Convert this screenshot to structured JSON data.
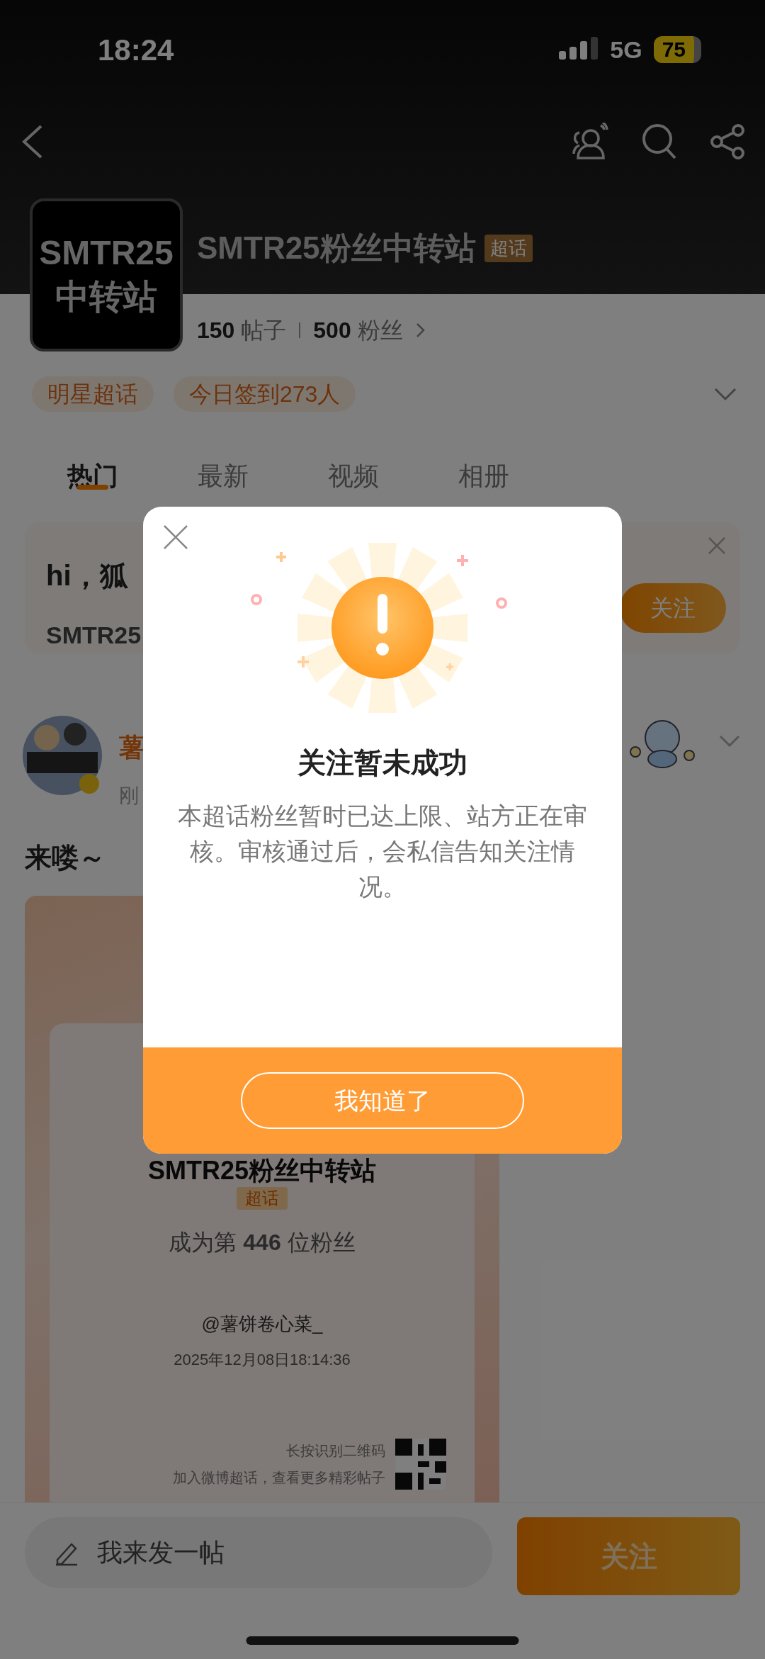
{
  "status_bar": {
    "time": "18:24",
    "network": "5G",
    "battery": "75"
  },
  "topic": {
    "avatar_lines": [
      "SMTR25",
      "中转站"
    ],
    "name": "SMTR25粉丝中转站",
    "badge": "超话",
    "stats": [
      "**150** 帖子",
      "**500** 粉丝"
    ]
  },
  "tags": [
    "明星超话",
    "今日签到273人"
  ],
  "tabs": [
    {
      "label": "热门",
      "selected": true
    },
    {
      "label": "最新",
      "selected": false
    },
    {
      "label": "视频",
      "selected": false
    },
    {
      "label": "相册",
      "selected": false
    }
  ],
  "welcome_card": {
    "greeting": "hi，狐",
    "subtitle": "SMTR25",
    "follow_button": "关注"
  },
  "post": {
    "author": "薯",
    "time": "刚",
    "text": "来喽～",
    "share_card": {
      "topic": "SMTR25粉丝中转站",
      "badge": "超话",
      "rank": "成为第 **446** 位粉丝",
      "user": "@薯饼卷心菜_",
      "date": "2025年12月08日18:14:36",
      "qr_hint": "长按识别二维码",
      "qr_note": "加入微博超话，查看更多精彩帖子"
    }
  },
  "bottom_bar": {
    "compose": "我来发一帖",
    "follow_button": "关注"
  },
  "dialog": {
    "title": "关注暂未成功",
    "message": "本超话粉丝暂时已达上限、站方正在审核。审核通过后，会私信告知关注情况。",
    "button": "我知道了"
  }
}
